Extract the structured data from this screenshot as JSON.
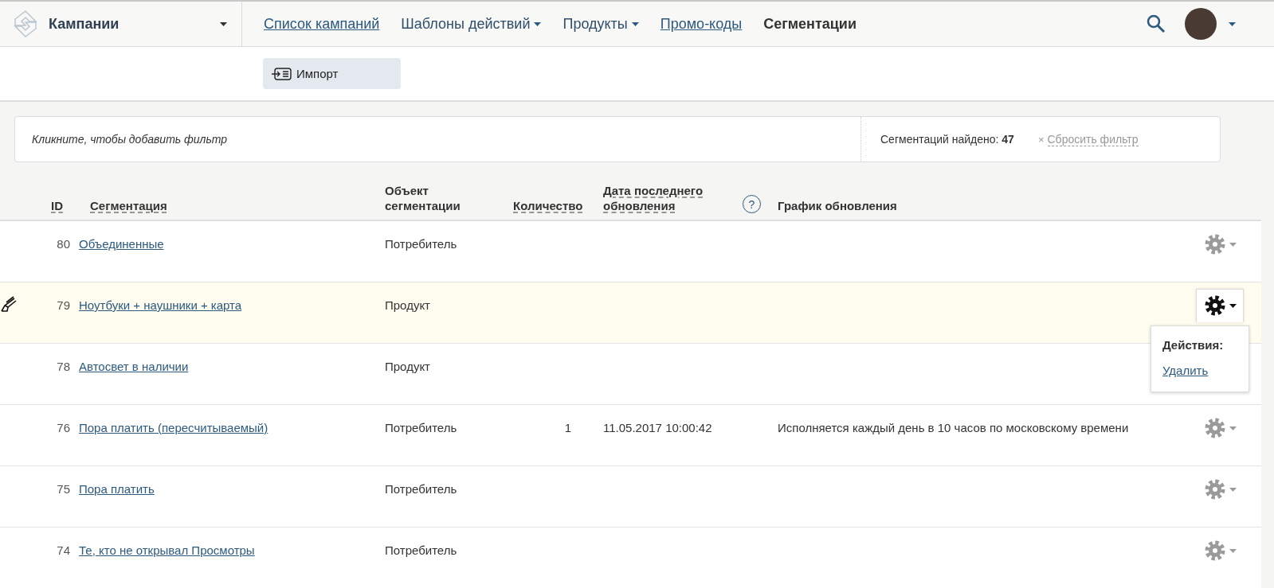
{
  "header": {
    "section": "Кампании",
    "nav": [
      {
        "label": "Список кампаний",
        "kind": "link",
        "selected": false
      },
      {
        "label": "Шаблоны действий",
        "kind": "dropdown",
        "selected": false
      },
      {
        "label": "Продукты",
        "kind": "dropdown",
        "selected": false
      },
      {
        "label": "Промо-коды",
        "kind": "link",
        "selected": false
      },
      {
        "label": "Сегментации",
        "kind": "link",
        "selected": true
      }
    ]
  },
  "toolbar": {
    "buttons": [
      "Импорт"
    ]
  },
  "filter": {
    "placeholder": "Кликните, чтобы добавить фильтр",
    "found_label": "Сегментаций найдено:",
    "found_count": "47",
    "reset_mark": "×",
    "reset": "Сбросить фильтр"
  },
  "table": {
    "help_mark": "?",
    "columns": [
      "ID",
      "Сегментация",
      "Объект сегментации",
      "Количество",
      "Дата последнего обновления",
      "График обновления"
    ],
    "rows": [
      {
        "id": "80",
        "name": "Объединенные",
        "object": "Потребитель",
        "count": "",
        "date": "",
        "schedule": "",
        "highlighted": false,
        "menu_open": false
      },
      {
        "id": "79",
        "name": "Ноутбуки + наушники + карта",
        "object": "Продукт",
        "count": "",
        "date": "",
        "schedule": "",
        "highlighted": true,
        "menu_open": true
      },
      {
        "id": "78",
        "name": "Автосвет в наличии",
        "object": "Продукт",
        "count": "",
        "date": "",
        "schedule": "",
        "highlighted": false,
        "menu_open": false
      },
      {
        "id": "76",
        "name": "Пора платить (пересчитываемый)",
        "object": "Потребитель",
        "count": "1",
        "date": "11.05.2017 10:00:42",
        "schedule": "Исполняется каждый день в 10 часов по московскому времени",
        "highlighted": false,
        "menu_open": false
      },
      {
        "id": "75",
        "name": "Пора платить",
        "object": "Потребитель",
        "count": "",
        "date": "",
        "schedule": "",
        "highlighted": false,
        "menu_open": false
      },
      {
        "id": "74",
        "name": "Те, кто не открывал Просмотры",
        "object": "Потребитель",
        "count": "",
        "date": "",
        "schedule": "",
        "highlighted": false,
        "menu_open": false
      }
    ]
  },
  "actions_menu": {
    "title": "Действия:",
    "items": [
      "Удалить"
    ]
  }
}
